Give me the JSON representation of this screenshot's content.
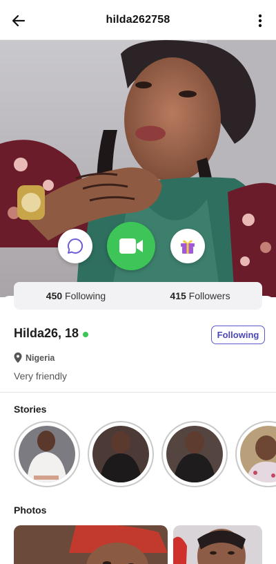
{
  "header": {
    "title": "hilda262758",
    "back_icon": "arrow-left-icon",
    "menu_icon": "more-vertical-icon"
  },
  "actions": {
    "chat_icon": "chat-bubble-icon",
    "video_icon": "video-camera-icon",
    "gift_icon": "gift-icon"
  },
  "stats": {
    "following_count": "450",
    "following_label": "Following",
    "followers_count": "415",
    "followers_label": "Followers"
  },
  "profile": {
    "name": "Hilda26, 18",
    "online": true,
    "follow_button": "Following",
    "location": "Nigeria",
    "bio": "Very friendly"
  },
  "sections": {
    "stories": "Stories",
    "photos": "Photos"
  },
  "colors": {
    "accent": "#5b57c9",
    "online": "#3ec557",
    "video_button": "#3ec557",
    "chat_icon": "#6b5ed6",
    "gift_icon": "#a05ad6"
  }
}
